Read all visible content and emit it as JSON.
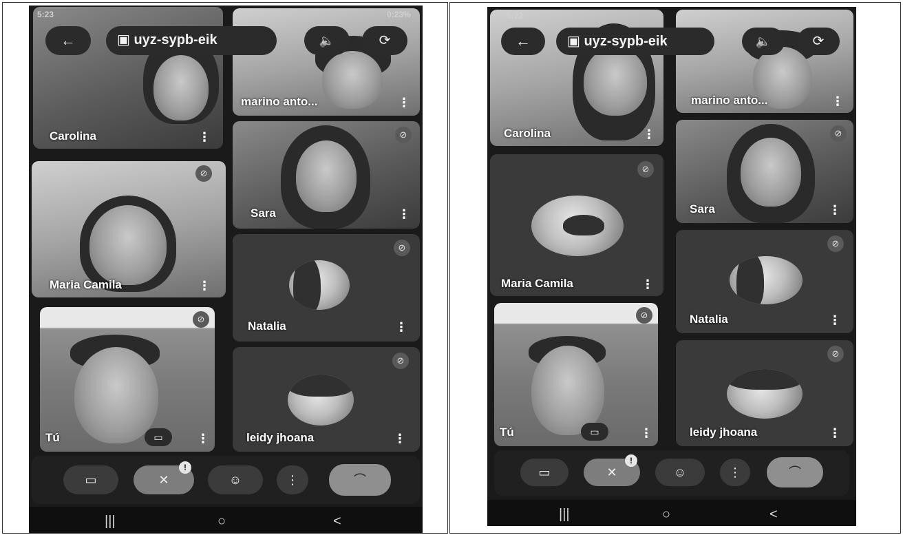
{
  "left": {
    "status_time": "5:23",
    "status_right": "0:23%",
    "meeting_code": "uyz-sypb-eik",
    "participants": {
      "carolina": "Carolina",
      "marino": "marino anto...",
      "sara": "Sara",
      "maria": "Maria Camila",
      "natalia": "Natalia",
      "tu": "Tú",
      "leidy": "leidy jhoana"
    },
    "mic_notification": "!"
  },
  "right": {
    "status_time": "5:22",
    "meeting_code": "uyz-sypb-eik",
    "participants": {
      "carolina": "Carolina",
      "marino": "marino anto...",
      "sara": "Sara",
      "maria": "Maria Camila",
      "natalia": "Natalia",
      "tu": "Tú",
      "leidy": "leidy jhoana"
    },
    "mic_notification": "!"
  },
  "icons": {
    "back": "←",
    "calendar": "▣",
    "speaker": "🔈",
    "camera_switch": "⟳",
    "more": "⋮",
    "mute": "⊘",
    "video": "▭",
    "mic_off": "✕",
    "emoji": "☺",
    "hangup": "⌒",
    "nav_recent": "|||",
    "nav_home": "○",
    "nav_back": "<"
  },
  "colors": {
    "background": "#1a1a1a",
    "tile": "#3a3a3a",
    "control_bar": "#202020"
  }
}
